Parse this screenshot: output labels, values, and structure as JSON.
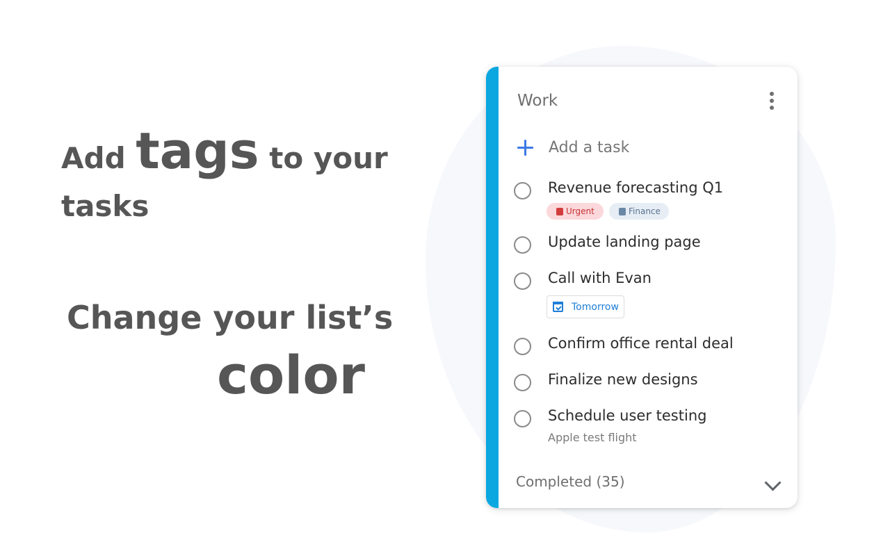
{
  "promo": {
    "line1_pre": "Add",
    "line1_big": "tags",
    "line1_post": "to your",
    "line2": "tasks",
    "line3": "Change your list’s",
    "line4": "color"
  },
  "card": {
    "accent_color": "#0aa7e0",
    "title": "Work",
    "menu_icon": "more-vert-icon",
    "add_task_label": "Add a task",
    "tasks": [
      {
        "title": "Revenue forecasting Q1",
        "tags": [
          {
            "label": "Urgent",
            "color": "#c83232"
          },
          {
            "label": "Finance",
            "color": "#5a7290"
          }
        ]
      },
      {
        "title": "Update landing page"
      },
      {
        "title": "Call with Evan",
        "due": "Tomorrow"
      },
      {
        "title": "Confirm office rental deal"
      },
      {
        "title": "Finalize new designs"
      },
      {
        "title": "Schedule user testing",
        "details": "Apple test flight"
      }
    ],
    "completed_label": "Completed (35)"
  }
}
